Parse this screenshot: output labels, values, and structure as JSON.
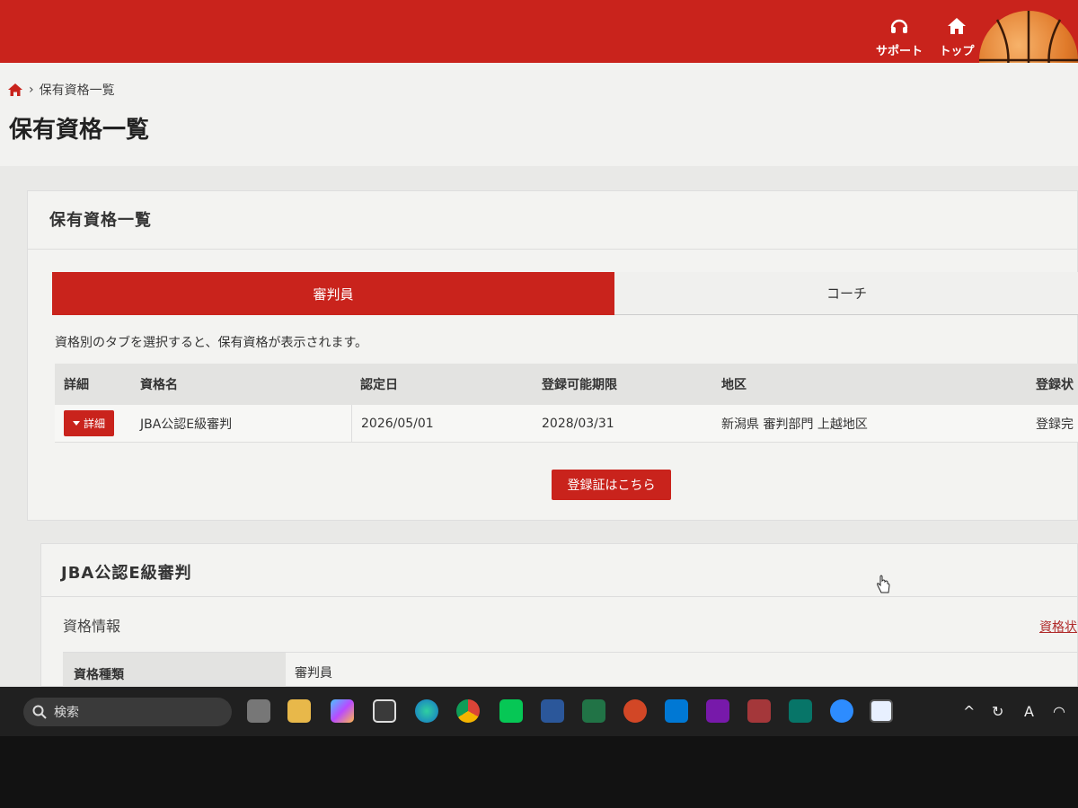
{
  "topnav": {
    "support_label": "サポート",
    "top_label": "トップ"
  },
  "breadcrumb": {
    "separator": "›",
    "current": "保有資格一覧"
  },
  "page_title": "保有資格一覧",
  "card": {
    "title": "保有資格一覧",
    "tabs": [
      {
        "label": "審判員",
        "active": true
      },
      {
        "label": "コーチ",
        "active": false
      }
    ],
    "hint": "資格別のタブを選択すると、保有資格が表示されます。",
    "table": {
      "headers": [
        "詳細",
        "資格名",
        "認定日",
        "登録可能期限",
        "地区",
        "登録状"
      ],
      "rows": [
        {
          "detail_button": "詳細",
          "name": "JBA公認E級審判",
          "certified_date": "2026/05/01",
          "registration_deadline": "2028/03/31",
          "district": "新潟県 審判部門 上越地区",
          "status": "登録完"
        }
      ]
    },
    "certificate_button": "登録証はこちら"
  },
  "detail_card": {
    "title": "JBA公認E級審判",
    "section_label": "資格情報",
    "right_link": "資格状",
    "info_rows": [
      {
        "key": "資格種類",
        "value": "審判員"
      }
    ]
  },
  "taskbar": {
    "search_placeholder": "検索",
    "tray_text": "A"
  },
  "colors": {
    "brand_red": "#c9231c",
    "taskbar": "#202020"
  }
}
